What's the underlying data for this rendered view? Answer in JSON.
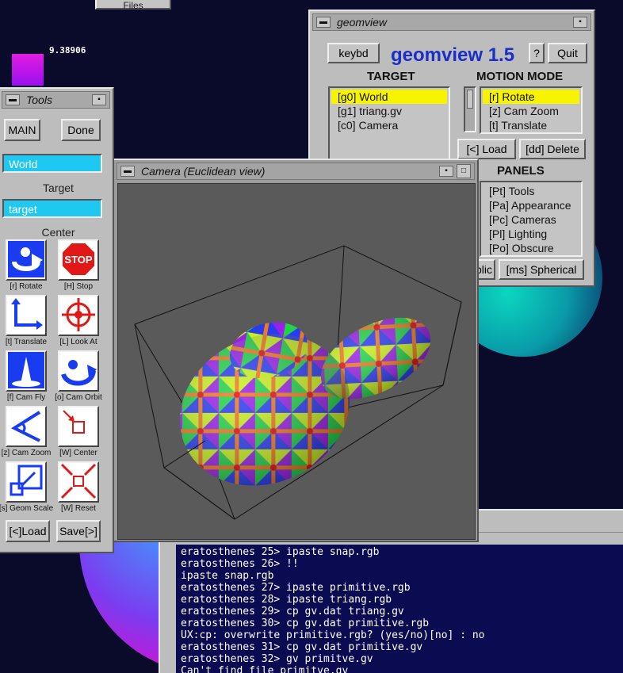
{
  "desktop": {
    "files_tab": "Files",
    "color_value": "9.38906"
  },
  "tools": {
    "title": "Tools",
    "main_button": "MAIN",
    "done_button": "Done",
    "center_field": "World",
    "target_label": "Target",
    "target_field": "target",
    "center_label": "Center",
    "icons": [
      {
        "label": "[r] Rotate",
        "icon": "rotate-icon"
      },
      {
        "label": "[H] Stop",
        "icon": "stop-icon"
      },
      {
        "label": "[t] Translate",
        "icon": "translate-icon"
      },
      {
        "label": "[L] Look At",
        "icon": "look-at-icon"
      },
      {
        "label": "[f] Cam Fly",
        "icon": "cam-fly-icon"
      },
      {
        "label": "[o] Cam Orbit",
        "icon": "cam-orbit-icon"
      },
      {
        "label": "[z] Cam Zoom",
        "icon": "cam-zoom-icon"
      },
      {
        "label": "[W] Center",
        "icon": "center-icon"
      },
      {
        "label": "[s] Geom Scale",
        "icon": "geom-scale-icon"
      },
      {
        "label": "[W] Reset",
        "icon": "reset-icon"
      }
    ],
    "load_button": "[<]Load",
    "save_button": "Save[>]"
  },
  "camera": {
    "title": "Camera (Euclidean view)"
  },
  "geomview": {
    "title": "geomview",
    "keybd_button": "keybd",
    "app_title": "geomview 1.5",
    "help_button": "?",
    "quit_button": "Quit",
    "target_header": "TARGET",
    "targets": [
      "[g0] World",
      "[g1] triang.gv",
      "[c0] Camera"
    ],
    "motion_header": "MOTION MODE",
    "motion_modes": [
      "[r] Rotate",
      "[z] Cam Zoom",
      "[t] Translate"
    ],
    "load_button": "[<] Load",
    "delete_button": "[dd] Delete",
    "panels_header": "PANELS",
    "panels": [
      "[Pt] Tools",
      "[Pa] Appearance",
      "[Pc] Cameras",
      "[Pl] Lighting",
      "[Po] Obscure"
    ],
    "hyperbolic_button": "blic",
    "spherical_button": "[ms] Spherical"
  },
  "terminal": {
    "lines": [
      "eratosthenes 25> ipaste snap.rgb",
      "eratosthenes 26> !!",
      "ipaste snap.rgb",
      "eratosthenes 27> ipaste primitive.rgb",
      "eratosthenes 28> ipaste triang.rgb",
      "eratosthenes 29> cp gv.dat triang.gv",
      "eratosthenes 30> cp gv.dat primitive.rgb",
      "UX:cp: overwrite primitive.rgb? (yes/no)[no] : no",
      "eratosthenes 31> cp gv.dat primitive.gv",
      "eratosthenes 32> gv primitve.gv",
      "Can't find file primitve.gv"
    ]
  },
  "colors": {
    "desktop": "#0a0a2a",
    "selection": "#f8f400",
    "field": "#1ec8f0",
    "app_title": "#1a2ec8",
    "terminal_bg": "#0b0b52"
  }
}
